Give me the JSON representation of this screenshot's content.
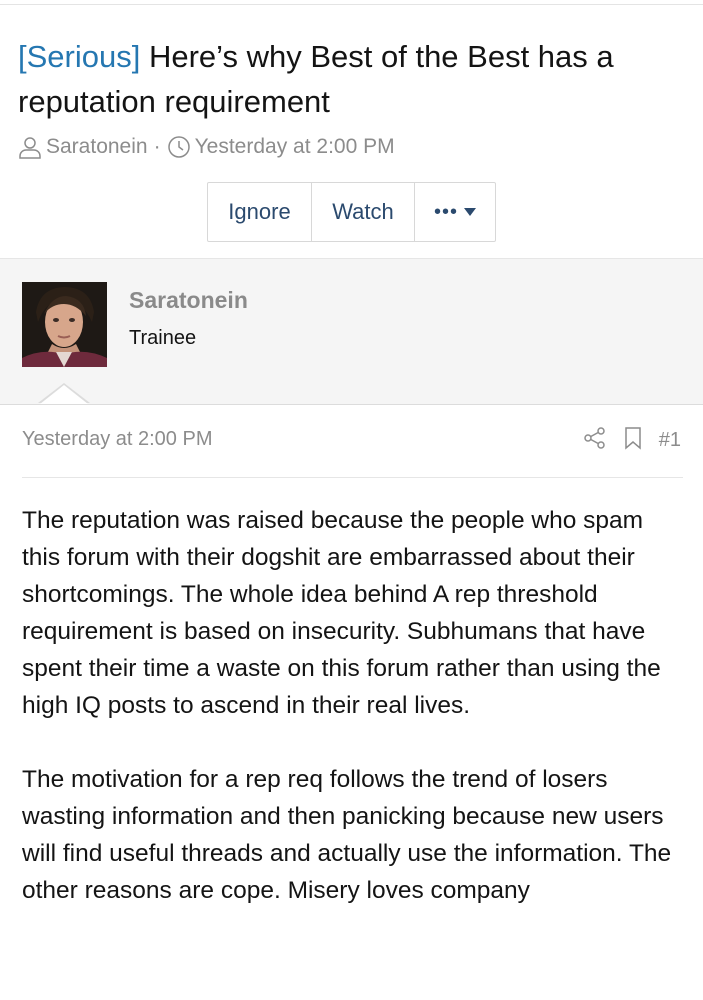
{
  "thread": {
    "prefix": "[Serious]",
    "title": "Here’s why Best of the Best has a reputation requirement",
    "author": "Saratonein",
    "date": "Yesterday at 2:00 PM"
  },
  "actions": {
    "ignore": "Ignore",
    "watch": "Watch",
    "more": "•••"
  },
  "poster": {
    "name": "Saratonein",
    "title": "Trainee"
  },
  "post": {
    "date": "Yesterday at 2:00 PM",
    "number": "#1",
    "paragraphs": [
      "The reputation was raised because the people who spam this forum with their dogshit are embarrassed about their shortcomings. The whole idea behind A rep threshold requirement is based on insecurity. Subhumans that have spent their time a waste on this forum rather than using the high IQ posts to ascend in their real lives.",
      "The motivation for a rep req follows the trend of losers wasting information and then panicking because new users will find useful threads and actually use the information. The other reasons are cope. Misery loves company"
    ]
  },
  "icons": {
    "author": "user-icon",
    "date": "clock-icon",
    "share": "share-icon",
    "bookmark": "bookmark-icon"
  }
}
